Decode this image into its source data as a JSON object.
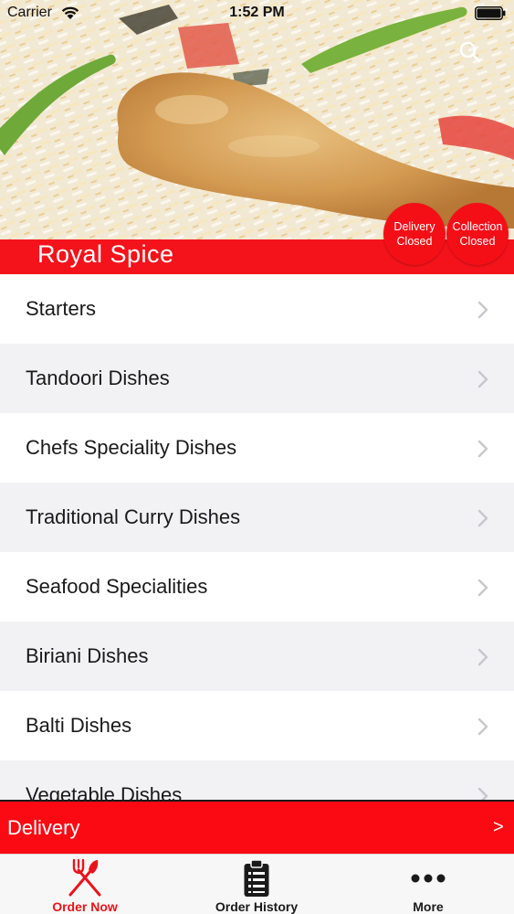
{
  "status_bar": {
    "carrier": "Carrier",
    "time": "1:52 PM"
  },
  "header": {
    "restaurant_name": "Royal Spice",
    "search_icon": "search-icon",
    "delivery_status": {
      "line1": "Delivery",
      "line2": "Closed"
    },
    "collection_status": {
      "line1": "Collection",
      "line2": "Closed"
    }
  },
  "menu": {
    "categories": [
      {
        "label": "Starters"
      },
      {
        "label": "Tandoori Dishes"
      },
      {
        "label": "Chefs Speciality Dishes"
      },
      {
        "label": "Traditional Curry Dishes"
      },
      {
        "label": "Seafood Specialities"
      },
      {
        "label": "Biriani Dishes"
      },
      {
        "label": "Balti Dishes"
      },
      {
        "label": "Vegetable Dishes"
      }
    ]
  },
  "delivery_bar": {
    "label": "Delivery",
    "arrow": ">"
  },
  "tab_bar": {
    "tabs": [
      {
        "label": "Order Now",
        "icon": "fork-knife-icon"
      },
      {
        "label": "Order History",
        "icon": "clipboard-list-icon"
      },
      {
        "label": "More",
        "icon": "more-dots-icon"
      }
    ]
  },
  "colors": {
    "accent_red": "#f4131b",
    "active_tab": "#e8141c",
    "row_alt": "#f2f2f4"
  }
}
